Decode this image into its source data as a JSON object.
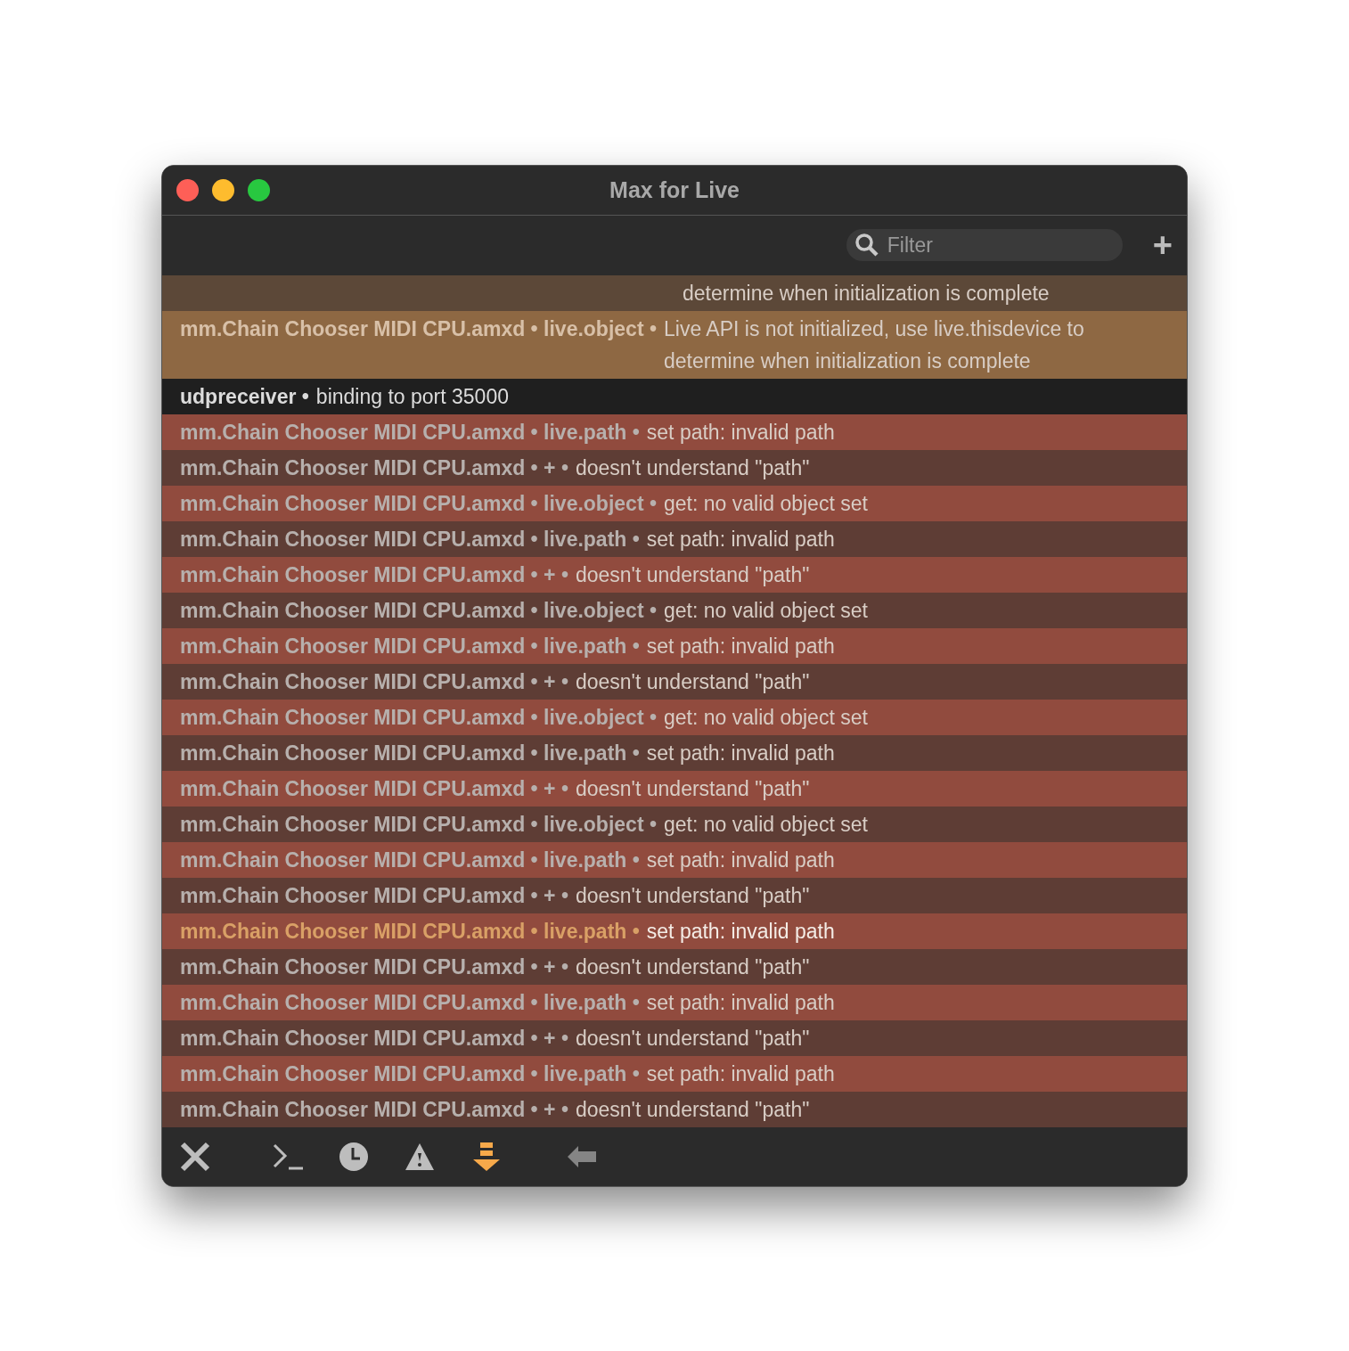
{
  "window": {
    "title": "Max for Live"
  },
  "toolbar": {
    "filter": {
      "placeholder": "Filter"
    },
    "add_button": "+"
  },
  "rows": [
    {
      "kind": "warning",
      "light": false,
      "selected": false,
      "message": [
        "determine when initialization is complete"
      ]
    },
    {
      "kind": "warning",
      "light": true,
      "selected": false,
      "source": "mm.Chain Chooser MIDI CPU.amxd • live.object •",
      "message": [
        "Live API is not initialized, use live.thisdevice to",
        "determine when initialization is complete"
      ]
    },
    {
      "kind": "info",
      "light": false,
      "selected": false,
      "source": "udpreceiver •",
      "message": [
        "binding to port 35000"
      ]
    },
    {
      "kind": "error",
      "light": true,
      "selected": false,
      "source": "mm.Chain Chooser MIDI CPU.amxd • live.path •",
      "message": [
        "set path: invalid path"
      ]
    },
    {
      "kind": "error",
      "light": false,
      "selected": false,
      "source": "mm.Chain Chooser MIDI CPU.amxd • + •",
      "message": [
        "doesn't understand \"path\""
      ]
    },
    {
      "kind": "error",
      "light": true,
      "selected": false,
      "source": "mm.Chain Chooser MIDI CPU.amxd • live.object •",
      "message": [
        "get: no valid object set"
      ]
    },
    {
      "kind": "error",
      "light": false,
      "selected": false,
      "source": "mm.Chain Chooser MIDI CPU.amxd • live.path •",
      "message": [
        "set path: invalid path"
      ]
    },
    {
      "kind": "error",
      "light": true,
      "selected": false,
      "source": "mm.Chain Chooser MIDI CPU.amxd • + •",
      "message": [
        "doesn't understand \"path\""
      ]
    },
    {
      "kind": "error",
      "light": false,
      "selected": false,
      "source": "mm.Chain Chooser MIDI CPU.amxd • live.object •",
      "message": [
        "get: no valid object set"
      ]
    },
    {
      "kind": "error",
      "light": true,
      "selected": false,
      "source": "mm.Chain Chooser MIDI CPU.amxd • live.path •",
      "message": [
        "set path: invalid path"
      ]
    },
    {
      "kind": "error",
      "light": false,
      "selected": false,
      "source": "mm.Chain Chooser MIDI CPU.amxd • + •",
      "message": [
        "doesn't understand \"path\""
      ]
    },
    {
      "kind": "error",
      "light": true,
      "selected": false,
      "source": "mm.Chain Chooser MIDI CPU.amxd • live.object •",
      "message": [
        "get: no valid object set"
      ]
    },
    {
      "kind": "error",
      "light": false,
      "selected": false,
      "source": "mm.Chain Chooser MIDI CPU.amxd • live.path •",
      "message": [
        "set path: invalid path"
      ]
    },
    {
      "kind": "error",
      "light": true,
      "selected": false,
      "source": "mm.Chain Chooser MIDI CPU.amxd • + •",
      "message": [
        "doesn't understand \"path\""
      ]
    },
    {
      "kind": "error",
      "light": false,
      "selected": false,
      "source": "mm.Chain Chooser MIDI CPU.amxd • live.object •",
      "message": [
        "get: no valid object set"
      ]
    },
    {
      "kind": "error",
      "light": true,
      "selected": false,
      "source": "mm.Chain Chooser MIDI CPU.amxd • live.path •",
      "message": [
        "set path: invalid path"
      ]
    },
    {
      "kind": "error",
      "light": false,
      "selected": false,
      "source": "mm.Chain Chooser MIDI CPU.amxd • + •",
      "message": [
        "doesn't understand \"path\""
      ]
    },
    {
      "kind": "error",
      "light": true,
      "selected": true,
      "source": "mm.Chain Chooser MIDI CPU.amxd • live.path •",
      "message": [
        "set path: invalid path"
      ]
    },
    {
      "kind": "error",
      "light": false,
      "selected": false,
      "source": "mm.Chain Chooser MIDI CPU.amxd • + •",
      "message": [
        "doesn't understand \"path\""
      ]
    },
    {
      "kind": "error",
      "light": true,
      "selected": false,
      "source": "mm.Chain Chooser MIDI CPU.amxd • live.path •",
      "message": [
        "set path: invalid path"
      ]
    },
    {
      "kind": "error",
      "light": false,
      "selected": false,
      "source": "mm.Chain Chooser MIDI CPU.amxd • + •",
      "message": [
        "doesn't understand \"path\""
      ]
    },
    {
      "kind": "error",
      "light": true,
      "selected": false,
      "source": "mm.Chain Chooser MIDI CPU.amxd • live.path •",
      "message": [
        "set path: invalid path"
      ]
    },
    {
      "kind": "error",
      "light": false,
      "selected": false,
      "source": "mm.Chain Chooser MIDI CPU.amxd • + •",
      "message": [
        "doesn't understand \"path\""
      ]
    }
  ],
  "bottom_tools": [
    {
      "kind": "clear",
      "on": false,
      "disabled": false
    },
    {
      "kind": "prompt",
      "on": false,
      "disabled": false
    },
    {
      "kind": "clock",
      "on": false,
      "disabled": false
    },
    {
      "kind": "warning",
      "on": false,
      "disabled": false
    },
    {
      "kind": "autoscroll",
      "on": true,
      "disabled": false
    },
    {
      "kind": "back",
      "on": false,
      "disabled": true
    }
  ]
}
